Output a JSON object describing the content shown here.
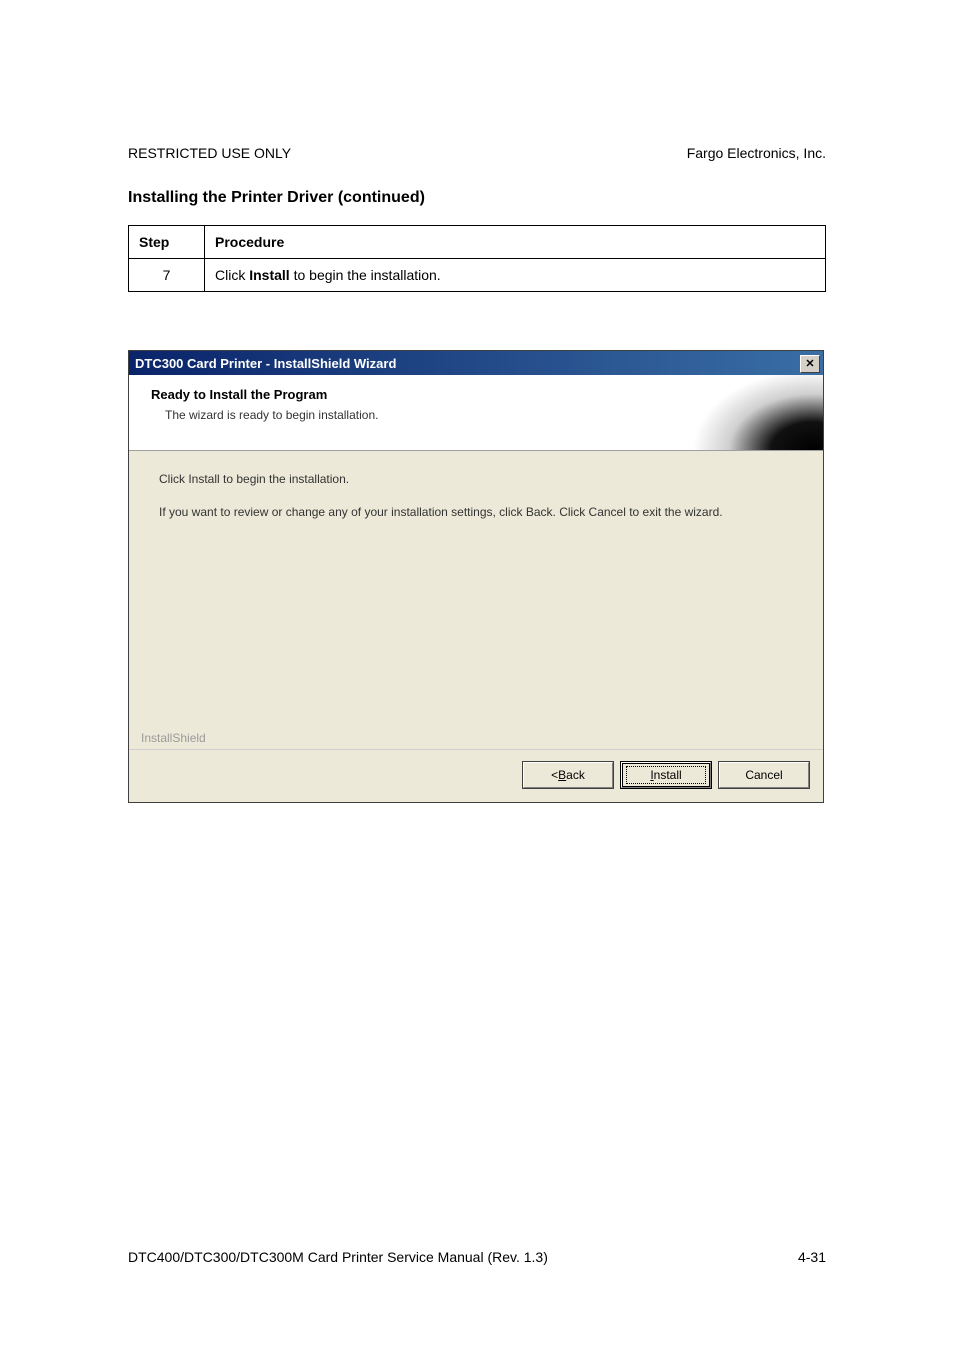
{
  "header": {
    "left": "RESTRICTED USE ONLY",
    "right": "Fargo Electronics, Inc."
  },
  "section_title": "Installing the Printer Driver (continued)",
  "table": {
    "headers": {
      "step": "Step",
      "procedure": "Procedure"
    },
    "row": {
      "step": "7",
      "procedure_prefix": "Click ",
      "procedure_bold": "Install",
      "procedure_suffix": " to begin the installation."
    }
  },
  "dialog": {
    "title": "DTC300 Card Printer - InstallShield Wizard",
    "close_glyph": "✕",
    "header_title": "Ready to Install the Program",
    "header_sub": "The wizard is ready to begin installation.",
    "body_line1": "Click Install to begin the installation.",
    "body_line2": "If you want to review or change any of your installation settings, click Back. Click Cancel to exit the wizard.",
    "brand": "InstallShield",
    "buttons": {
      "back_prefix": "< ",
      "back_mnemonic": "B",
      "back_rest": "ack",
      "install_mnemonic": "I",
      "install_rest": "nstall",
      "cancel": "Cancel"
    }
  },
  "footer": {
    "left": "DTC400/DTC300/DTC300M Card Printer Service Manual (Rev. 1.3)",
    "right": "4-31"
  }
}
